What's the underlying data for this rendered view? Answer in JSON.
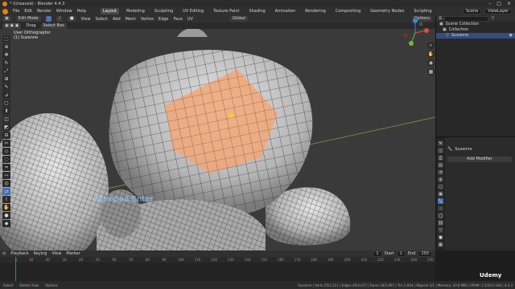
{
  "window": {
    "title": "* (Unsaved) - Blender 4.4.3",
    "minimize": "–",
    "maximize": "□",
    "close": "×"
  },
  "menu": {
    "items": [
      "File",
      "Edit",
      "Render",
      "Window",
      "Help"
    ],
    "workspaces": [
      "Layout",
      "Modeling",
      "Sculpting",
      "UV Editing",
      "Texture Paint",
      "Shading",
      "Animation",
      "Rendering",
      "Compositing",
      "Geometry Nodes",
      "Scripting"
    ],
    "scene": "Scene",
    "view_layer": "ViewLayer"
  },
  "header": {
    "mode": "Edit Mode",
    "view": "View",
    "select": "Select",
    "add": "Add",
    "mesh": "Mesh",
    "vertex": "Vertex",
    "edge": "Edge",
    "face": "Face",
    "uv": "UV",
    "orientation": "Global",
    "options": "Options"
  },
  "toolrow": {
    "drag_label": "Drag",
    "select_box": "Select Box"
  },
  "viewport": {
    "view_name": "User Orthographic",
    "object_info": "(1) Suzanne",
    "key_hint": "Numpad Enter"
  },
  "outliner": {
    "search": "",
    "rows": [
      "Scene Collection",
      "Collection",
      "Suzanne"
    ]
  },
  "properties": {
    "object_name": "Suzanne",
    "modifier_button": "Add Modifier"
  },
  "timeline": {
    "menus": [
      "Playback",
      "Keying",
      "View",
      "Marker"
    ],
    "current_frame": "1",
    "start_label": "Start",
    "start": "1",
    "end_label": "End",
    "end": "250",
    "ticks": [
      "1",
      "10",
      "20",
      "30",
      "40",
      "50",
      "60",
      "70",
      "80",
      "90",
      "100",
      "110",
      "120",
      "130",
      "140",
      "150",
      "160",
      "170",
      "180",
      "190",
      "200",
      "210",
      "220",
      "230",
      "240",
      "250"
    ]
  },
  "status": {
    "left": [
      "Select",
      "Rotate View",
      "Options"
    ],
    "right": "Suzanne | Verts 25/1,511 | Edges 40/3,017 | Faces 16/1,967 | Tris 2,934 | Objects 1/1 | Memory: 33.8 MiB | VRAM: 1.5/24.0 GiB | 4.4.3"
  },
  "brand": "Udemy",
  "colors": {
    "accent": "#4772b3",
    "selection": "#f2a777",
    "orange": "#e87d0d"
  }
}
